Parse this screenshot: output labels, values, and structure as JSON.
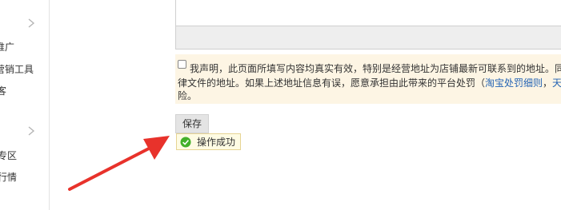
{
  "sidebar": {
    "items": [
      {
        "label": "推广",
        "icon": "chevron-right-icon"
      },
      {
        "label": "营销工具"
      },
      {
        "label": "客"
      },
      {
        "label": "专区",
        "icon": "chevron-right-icon"
      },
      {
        "label": "行情"
      }
    ]
  },
  "declaration": {
    "line1": "我声明，此页面所填写内容均真实有效，特别是经营地址为店铺最新可联系到的地址。同",
    "line2_prefix": "律文件的地址。如果上述地址信息有误，愿意承担由此带来的平台处罚（",
    "link1": "淘宝处罚细则",
    "separator": "，",
    "link2": "天",
    "line3": "险。"
  },
  "actions": {
    "save_label": "保存"
  },
  "toast": {
    "text": "操作成功",
    "icon": "check-circle-icon"
  },
  "annotation": {
    "icon": "red-arrow-icon",
    "color": "#e8322b"
  }
}
